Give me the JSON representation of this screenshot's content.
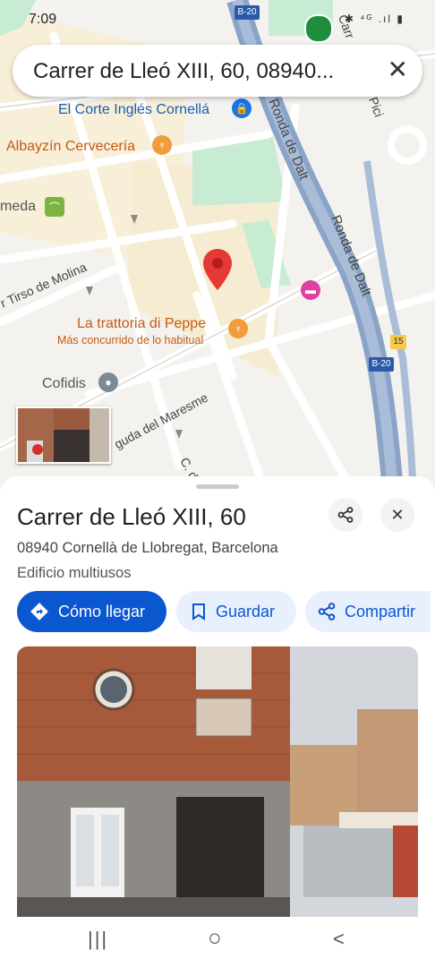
{
  "status_bar": {
    "time": "7:09",
    "icons_text": "✱ ⁴ᴳ .ıl ▮"
  },
  "search": {
    "query": "Carrer de Lleó XIII, 60, 08940...",
    "close_icon": "close-icon"
  },
  "map": {
    "road_shields": [
      "B-20",
      "B-20",
      "15"
    ],
    "pois": [
      {
        "label": "El Corte Inglés Cornellá",
        "icon": "shopping-bag-icon"
      },
      {
        "label": "Albayzín Cervecería",
        "icon": "restaurant-icon"
      },
      {
        "label": "meda",
        "icon": "park-icon"
      },
      {
        "label": "La trattoria di Peppe",
        "icon": "restaurant-icon",
        "sublabel": "Más concurrido de lo habitual"
      },
      {
        "label": "Cofidis",
        "icon": "pin-icon"
      }
    ],
    "streets": [
      "Carrer de Tirso de Molina",
      "Ronda de Dalt",
      "Ronda de Dalt",
      "Avinguda del Maresme",
      "C. de",
      "Carr",
      "Pici"
    ],
    "street_display": {
      "tirso": "r Tirso de Molina",
      "ronda1": "Ronda de Dalt",
      "ronda2": "Ronda de Dalt",
      "maresme": "guda del Maresme",
      "cde": "C. de",
      "carr": "Carr",
      "pici": "Pici"
    },
    "colors": {
      "road": "#ffffff",
      "highway": "#8aa4c8",
      "park": "#c7ecd3",
      "block": "#f8efd9",
      "pin": "#e53935"
    }
  },
  "place": {
    "title": "Carrer de Lleó XIII, 60",
    "address": "08940 Cornellà de Llobregat, Barcelona",
    "type": "Edificio multiusos",
    "actions": {
      "directions": "Cómo llegar",
      "save": "Guardar",
      "share": "Compartir"
    },
    "share_icon": "share-icon",
    "close_icon": "close-icon"
  },
  "nav": {
    "recents": "|||",
    "home": "○",
    "back": "<"
  }
}
